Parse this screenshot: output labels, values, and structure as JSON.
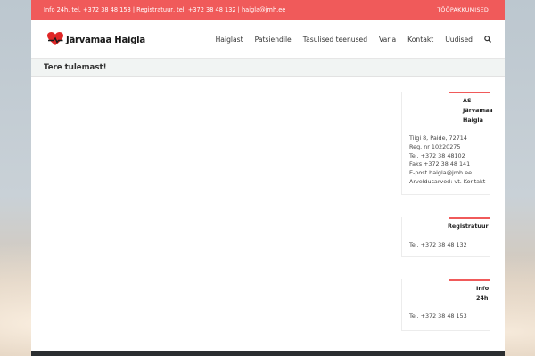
{
  "topbar": {
    "contact_text": "Info 24h, tel. +372 38 48 153 | Registratuur, tel. +372 38 48 132 | haigla@jmh.ee",
    "jobs_link": "TÖÖPAKKUMISED"
  },
  "header": {
    "logo_text": "Järvamaa Haigla",
    "nav": [
      {
        "label": "Haiglast"
      },
      {
        "label": "Patsiendile"
      },
      {
        "label": "Tasulised teenused"
      },
      {
        "label": "Varia"
      },
      {
        "label": "Kontakt"
      },
      {
        "label": "Uudised"
      }
    ],
    "search_icon": "search-icon"
  },
  "page": {
    "title": "Tere tulemast!"
  },
  "widgets": [
    {
      "title_lines": [
        "AS",
        "Järvamaa",
        "Haigla"
      ],
      "lines": [
        "Tiigi 8, Paide, 72714",
        "Reg. nr 10220275",
        "Tel. +372 38 48102",
        "Faks +372 38 48 141",
        "E-post haigla@jmh.ee",
        "Arveldusarved: vt. Kontakt"
      ]
    },
    {
      "title_lines": [
        "Registratuur"
      ],
      "lines": [
        "Tel. +372 38 48 132"
      ]
    },
    {
      "title_lines": [
        "Info",
        "24h"
      ],
      "lines": [
        "Tel. +372 38 48 153"
      ]
    }
  ],
  "colors": {
    "accent": "#f05a5a",
    "footer": "#2b2e30"
  }
}
